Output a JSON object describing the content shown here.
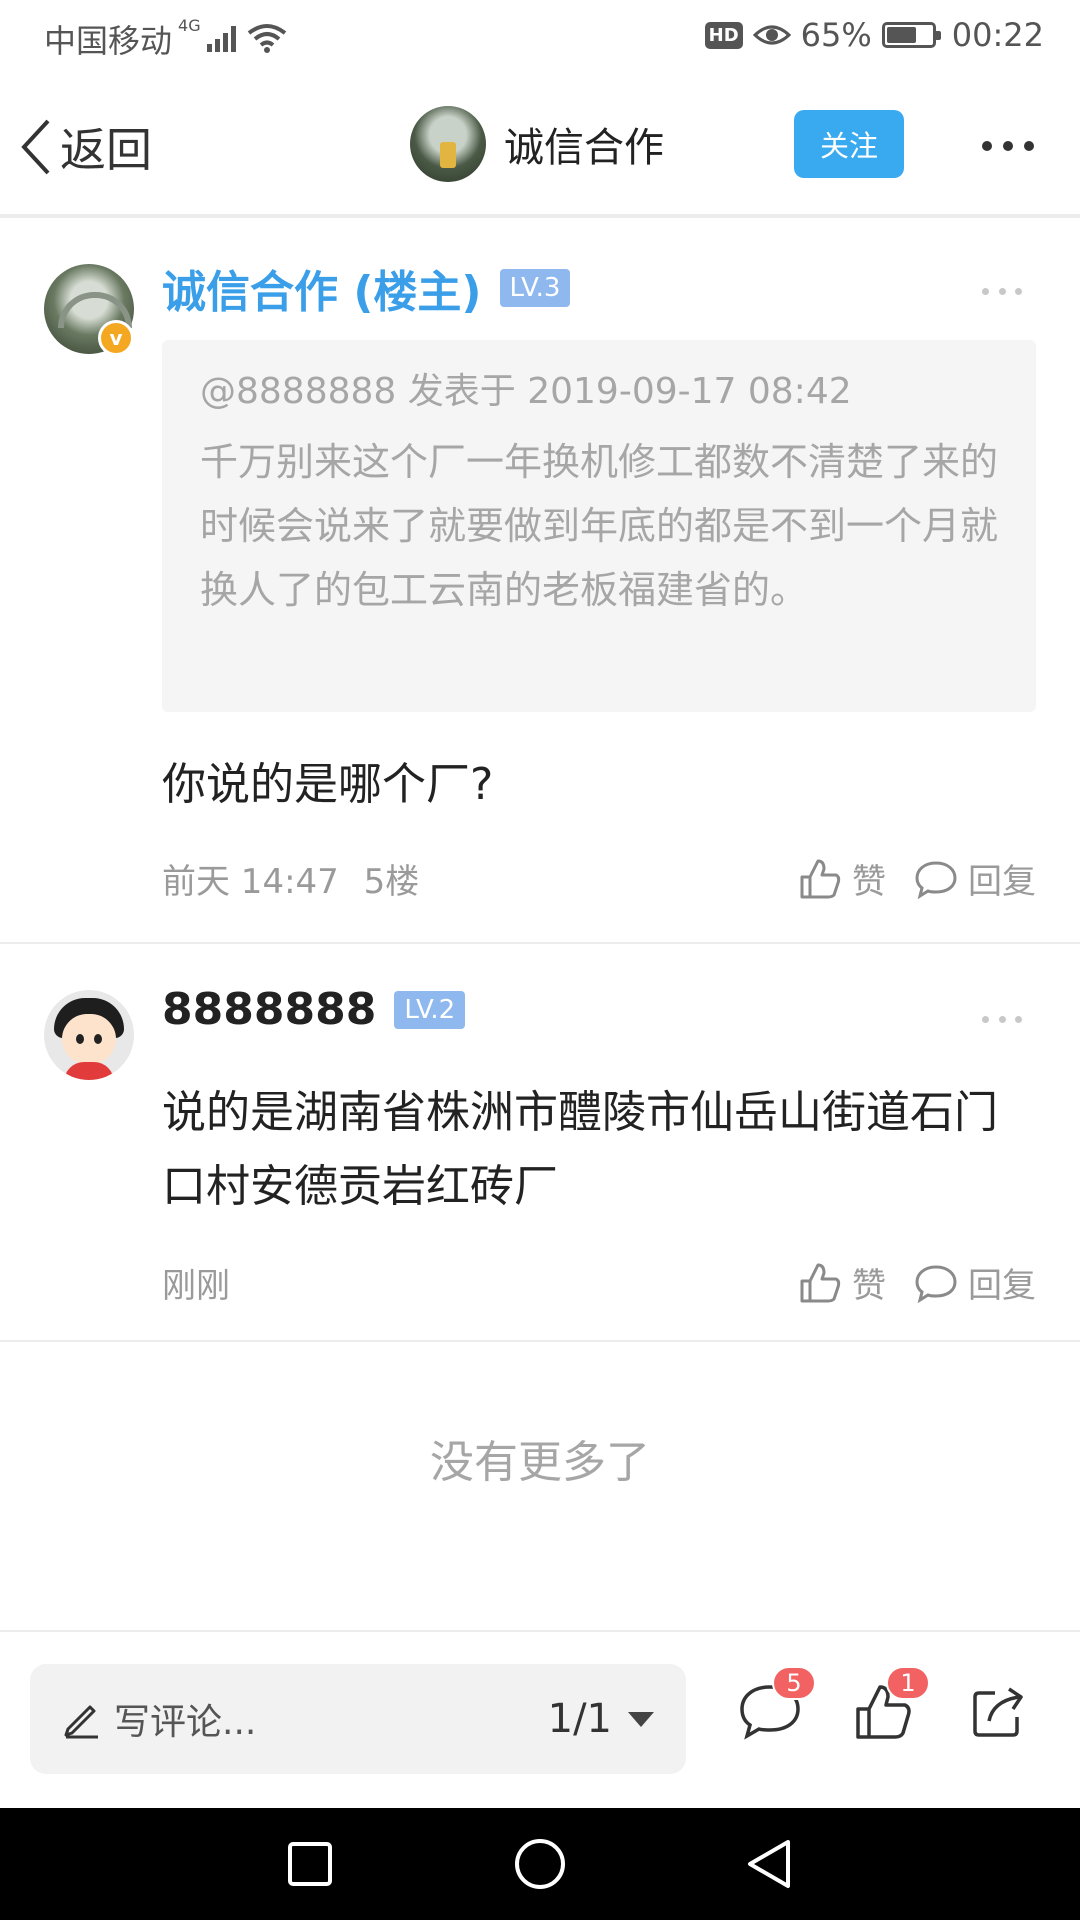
{
  "status_bar": {
    "carrier": "中国移动",
    "network": "4G",
    "hd": "HD",
    "battery": "65%",
    "battery_level": 0.65,
    "time": "00:22"
  },
  "header": {
    "back_label": "返回",
    "title": "诚信合作",
    "follow_label": "关注"
  },
  "posts": [
    {
      "name": "诚信合作 (楼主)",
      "level": "LV.3",
      "quote_meta": "@8888888 发表于 2019-09-17 08:42",
      "quote_text": "千万别来这个厂一年换机修工都数不清楚了来的时候会说来了就要做到年底的都是不到一个月就换人了的包工云南的老板福建省的。",
      "body": "你说的是哪个厂?",
      "time": "前天 14:47",
      "floor": "5楼",
      "like_label": "赞",
      "reply_label": "回复"
    },
    {
      "name": "8888888",
      "level": "LV.2",
      "body": "说的是湖南省株洲市醴陵市仙岳山街道石门口村安德贡岩红砖厂",
      "time": "刚刚",
      "like_label": "赞",
      "reply_label": "回复"
    }
  ],
  "no_more": "没有更多了",
  "bottom_bar": {
    "comment_placeholder": "写评论...",
    "page": "1/1",
    "comment_count": "5",
    "like_count": "1"
  },
  "colors": {
    "accent": "#3aaaf0",
    "owner_name": "#3a9ee8",
    "level_badge": "#8fb8ef",
    "count_badge": "#f26263"
  }
}
